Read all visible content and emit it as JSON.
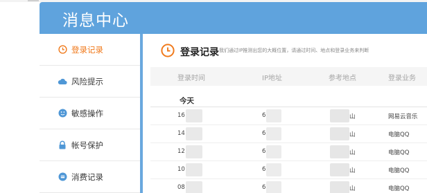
{
  "header": {
    "title": "消息中心"
  },
  "sidebar": {
    "items": [
      {
        "label": "登录记录",
        "icon": "clock-icon",
        "active": true
      },
      {
        "label": "风险提示",
        "icon": "cloud-icon",
        "active": false
      },
      {
        "label": "敏感操作",
        "icon": "smiley-icon",
        "active": false
      },
      {
        "label": "帐号保护",
        "icon": "lock-icon",
        "active": false
      },
      {
        "label": "消费记录",
        "icon": "coin-icon",
        "active": false
      }
    ]
  },
  "main": {
    "title": "登录记录",
    "description": "我们通过IP推测出您的大概位置，请通过时间、地点和登录业务来判断",
    "columns": [
      "登录时间",
      "IP地址",
      "参考地点",
      "登录业务"
    ],
    "day_label": "今天",
    "rows": [
      {
        "time": "16",
        "ip": "6",
        "place": "山",
        "service": "网易云音乐"
      },
      {
        "time": "14",
        "ip": "6",
        "place": "山",
        "service": "电脑QQ"
      },
      {
        "time": "12",
        "ip": "6",
        "place": "山",
        "service": "电脑QQ"
      },
      {
        "time": "10",
        "ip": "6",
        "place": "山",
        "service": "电脑QQ"
      },
      {
        "time": "08",
        "ip": "6",
        "place": "山",
        "service": "电脑QQ"
      }
    ]
  },
  "colors": {
    "accent_blue": "#5fa3dd",
    "active_orange": "#f07a1c"
  }
}
